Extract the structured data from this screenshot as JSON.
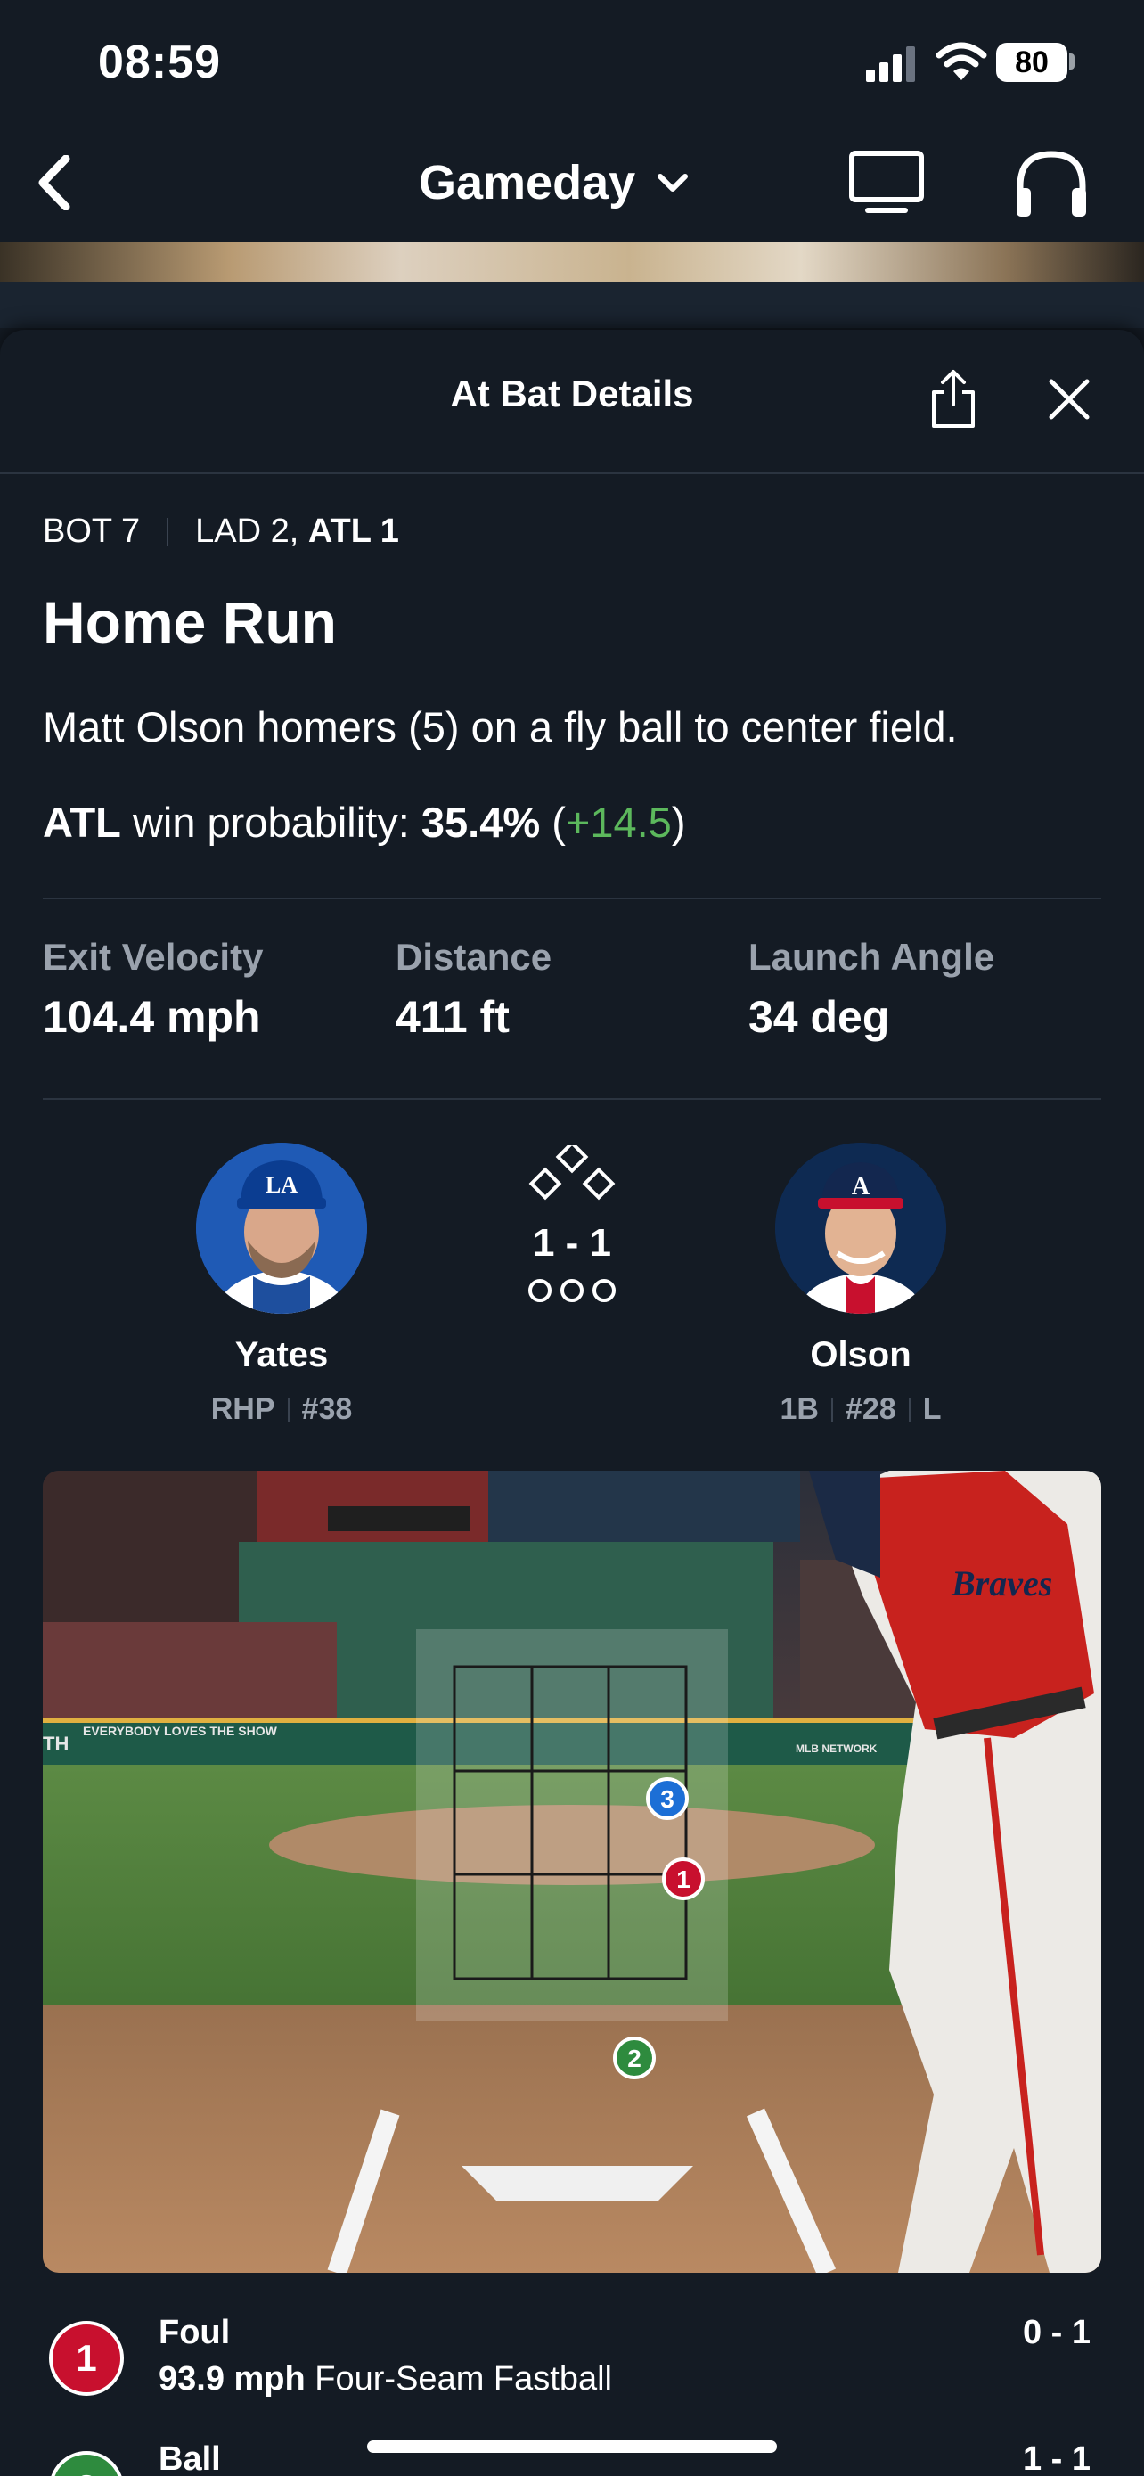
{
  "status": {
    "time": "08:59",
    "battery": "80"
  },
  "nav": {
    "title": "Gameday"
  },
  "sheet": {
    "title": "At Bat Details"
  },
  "play": {
    "inning": "BOT 7",
    "score_away": "LAD 2,",
    "score_home": "ATL 1",
    "headline": "Home Run",
    "description": "Matt Olson homers (5) on a fly ball to center field.",
    "win_team": "ATL",
    "win_label": "win probability:",
    "win_pct": "35.4%",
    "win_delta": "+14.5"
  },
  "stats": [
    {
      "label": "Exit Velocity",
      "value": "104.4 mph"
    },
    {
      "label": "Distance",
      "value": "411 ft"
    },
    {
      "label": "Launch Angle",
      "value": "34 deg"
    }
  ],
  "matchup": {
    "count": "1 - 1",
    "pitcher": {
      "name": "Yates",
      "hand": "RHP",
      "number": "#38"
    },
    "batter": {
      "name": "Olson",
      "pos": "1B",
      "number": "#28",
      "bats": "L"
    }
  },
  "scene": {
    "banner": "EVERYBODY LOVES THE SHOW",
    "wall_left": "TH",
    "network": "MLB NETWORK",
    "jersey": "Braves"
  },
  "pitches": [
    {
      "num": "1",
      "result": "Foul",
      "speed": "93.9 mph",
      "type": "Four-Seam Fastball",
      "count": "0 - 1",
      "color": "#c8102e"
    },
    {
      "num": "2",
      "result": "Ball",
      "speed": "",
      "type": "",
      "count": "1 - 1",
      "color": "#2e8b3e"
    },
    {
      "num": "3",
      "result": "",
      "speed": "",
      "type": "",
      "count": "",
      "color": "#1c6fd6"
    }
  ],
  "colors": {
    "background": "#141b24",
    "win_delta": "#5cb85c",
    "muted": "#9aa2ad"
  }
}
